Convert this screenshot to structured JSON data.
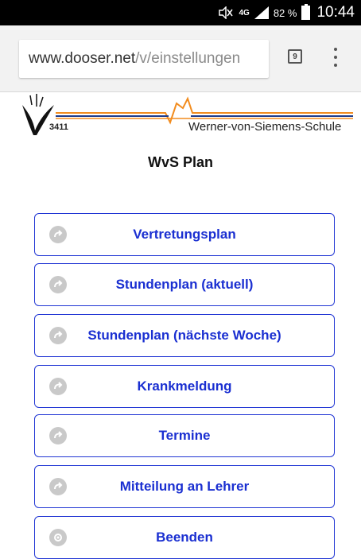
{
  "status_bar": {
    "network": "4G",
    "battery": "82 %",
    "time": "10:44"
  },
  "browser": {
    "url_host": "www.dooser.net",
    "url_path": "/v/einstellungen",
    "tab_count": "9"
  },
  "header": {
    "school_number": "3411",
    "school_name": "Werner-von-Siemens-Schule",
    "title": "WvS Plan"
  },
  "menu": {
    "items": [
      {
        "label": "Vertretungsplan",
        "icon": "arrow-right-circle-icon"
      },
      {
        "label": "Stundenplan (aktuell)",
        "icon": "arrow-right-circle-icon"
      },
      {
        "label": "Stundenplan (nächste Woche)",
        "icon": "arrow-right-circle-icon"
      },
      {
        "label": "Krankmeldung",
        "icon": "arrow-right-circle-icon"
      },
      {
        "label": "Termine",
        "icon": "arrow-right-circle-icon"
      },
      {
        "label": "Mitteilung an Lehrer",
        "icon": "arrow-right-circle-icon"
      },
      {
        "label": "Beenden",
        "icon": "gear-icon"
      }
    ]
  },
  "colors": {
    "accent": "#1a2fd1",
    "logo_orange": "#f28c1e",
    "logo_blue": "#1f3c8c"
  }
}
